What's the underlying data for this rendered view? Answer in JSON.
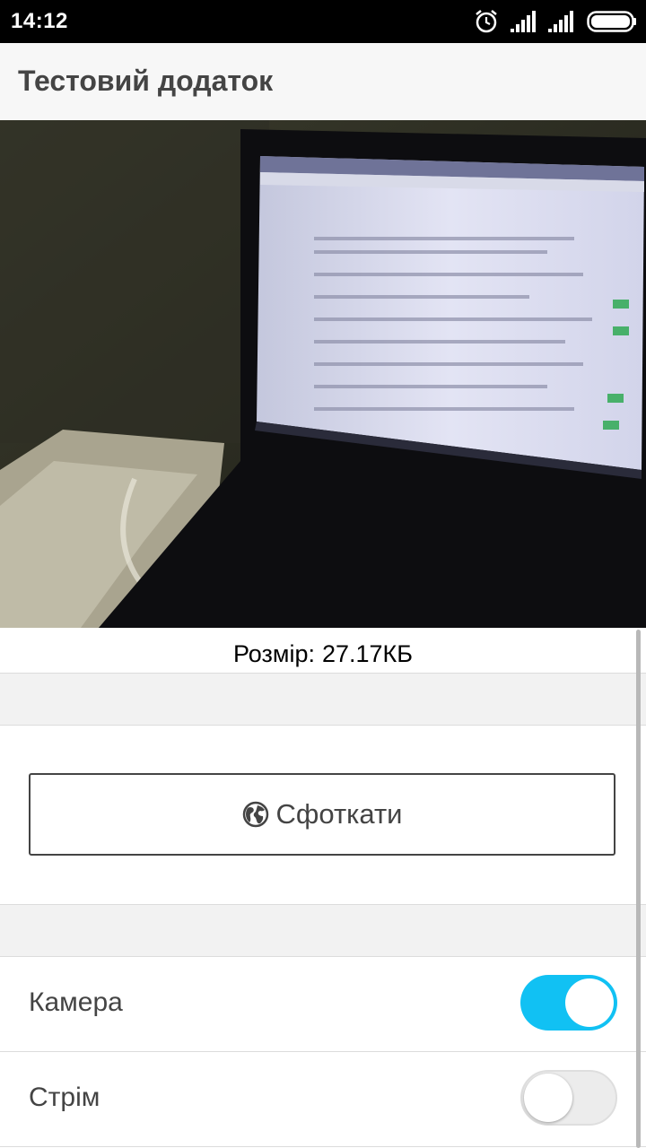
{
  "status_bar": {
    "time": "14:12"
  },
  "app_bar": {
    "title": "Тестовий додаток"
  },
  "photo": {
    "subject": "laptop-screen-photo"
  },
  "size": {
    "label": "Розмір:",
    "value": "27.17КБ"
  },
  "capture_button": {
    "label": "Сфоткати",
    "icon": "globe-icon"
  },
  "toggles": [
    {
      "label": "Камера",
      "checked": true
    },
    {
      "label": "Стрім",
      "checked": false
    }
  ],
  "colors": {
    "accent": "#11c1f3",
    "statusbar": "#000000",
    "appbar": "#f7f7f7",
    "section_gap": "#f2f2f2"
  }
}
